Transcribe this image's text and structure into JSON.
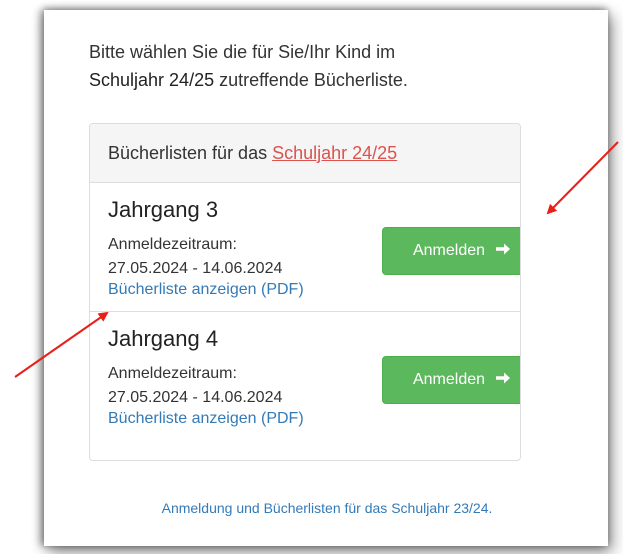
{
  "intro": {
    "line1": "Bitte wählen Sie die für Sie/Ihr Kind im",
    "strong": "Schuljahr 24/25",
    "line2_rest": " zutreffende Bücherliste."
  },
  "panel": {
    "heading_prefix": "Bücherlisten für das",
    "heading_link": "Schuljahr 24/25",
    "items": [
      {
        "title": "Jahrgang 3",
        "period_label": "Anmeldezeitraum:",
        "period_dates": "27.05.2024 - 14.06.2024",
        "pdf_link": "Bücherliste anzeigen (PDF)",
        "button_label": "Anmelden",
        "button_icon": "arrow-right-icon"
      },
      {
        "title": "Jahrgang 4",
        "period_label": "Anmeldezeitraum:",
        "period_dates": "27.05.2024 - 14.06.2024",
        "pdf_link": "Bücherliste anzeigen (PDF)",
        "button_label": "Anmelden",
        "button_icon": "arrow-right-icon"
      }
    ]
  },
  "footer_link": "Anmeldung und Bücherlisten für das Schuljahr 23/24.",
  "colors": {
    "button": "#5cb85c",
    "link": "#337ab7",
    "heading_link": "#d9534f",
    "annotation_arrow": "#e8201a"
  }
}
